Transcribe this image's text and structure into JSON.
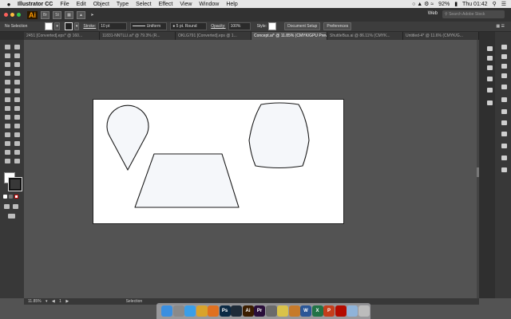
{
  "menubar": {
    "app_name": "Illustrator CC",
    "items": [
      "File",
      "Edit",
      "Object",
      "Type",
      "Select",
      "Effect",
      "View",
      "Window",
      "Help"
    ],
    "battery": "92%",
    "clock": "Thu 01:42"
  },
  "appbar": {
    "app_badge": "Ai",
    "workspace": "Web",
    "search_placeholder": "Search Adobe Stock"
  },
  "control": {
    "selection": "No Selection",
    "stroke_label": "Stroke:",
    "stroke_value": "10 pt",
    "profile": "Uniform",
    "brush": "5 pt. Round",
    "opacity_label": "Opacity:",
    "opacity_value": "100%",
    "style_label": "Style:",
    "doc_setup": "Document Setup",
    "preferences": "Preferences"
  },
  "tabs": [
    {
      "label": "2451 [Converted].eps* @ 160...",
      "active": false
    },
    {
      "label": "11831-NNTLLI.ai* @ 79.3% (R...",
      "active": false
    },
    {
      "label": "OKLG791 [Converted].eps @ 1...",
      "active": false
    },
    {
      "label": "Concept.ai* @ 11.85% (CMYK/GPU Preview)",
      "active": true
    },
    {
      "label": "ShuttleBus.ai @ 86.11% (CMYK...",
      "active": false
    },
    {
      "label": "Untitled-4* @ 11.6% (CMYK/G...",
      "active": false
    }
  ],
  "status": {
    "zoom": "11.85%",
    "page": "1",
    "tool": "Selection"
  },
  "dock_icons": [
    {
      "name": "finder-icon",
      "glyph": "",
      "color": "#3b8fe0"
    },
    {
      "name": "launchpad-icon",
      "glyph": "",
      "color": "#8a8a8a"
    },
    {
      "name": "safari-icon",
      "glyph": "",
      "color": "#3a9ee8"
    },
    {
      "name": "chrome-icon",
      "glyph": "",
      "color": "#d9a32b"
    },
    {
      "name": "firefox-icon",
      "glyph": "",
      "color": "#e0701f"
    },
    {
      "name": "photoshop-icon",
      "glyph": "Ps",
      "color": "#0c2a44"
    },
    {
      "name": "lightroom-icon",
      "glyph": "",
      "color": "#1e2b38"
    },
    {
      "name": "illustrator-icon",
      "glyph": "Ai",
      "color": "#3b1d00"
    },
    {
      "name": "premiere-icon",
      "glyph": "Pr",
      "color": "#2a0e3a"
    },
    {
      "name": "notes-icon",
      "glyph": "",
      "color": "#6b6b6b"
    },
    {
      "name": "stickies-icon",
      "glyph": "",
      "color": "#d9c24a"
    },
    {
      "name": "ibooks-icon",
      "glyph": "",
      "color": "#c77a2a"
    },
    {
      "name": "word-icon",
      "glyph": "W",
      "color": "#2b5797"
    },
    {
      "name": "excel-icon",
      "glyph": "X",
      "color": "#217346"
    },
    {
      "name": "powerpoint-icon",
      "glyph": "P",
      "color": "#c43e1c"
    },
    {
      "name": "acrobat-icon",
      "glyph": "",
      "color": "#b30b00"
    },
    {
      "name": "preview-icon",
      "glyph": "",
      "color": "#8fb3d9"
    },
    {
      "name": "trash-icon",
      "glyph": "",
      "color": "#bcbcbc"
    }
  ],
  "colors": {
    "workspace_bg": "#535353",
    "panel_bg": "#383838",
    "artboard": "#ffffff",
    "shape_fill": "#f5f7fa",
    "shape_stroke": "#1a1a1a"
  }
}
